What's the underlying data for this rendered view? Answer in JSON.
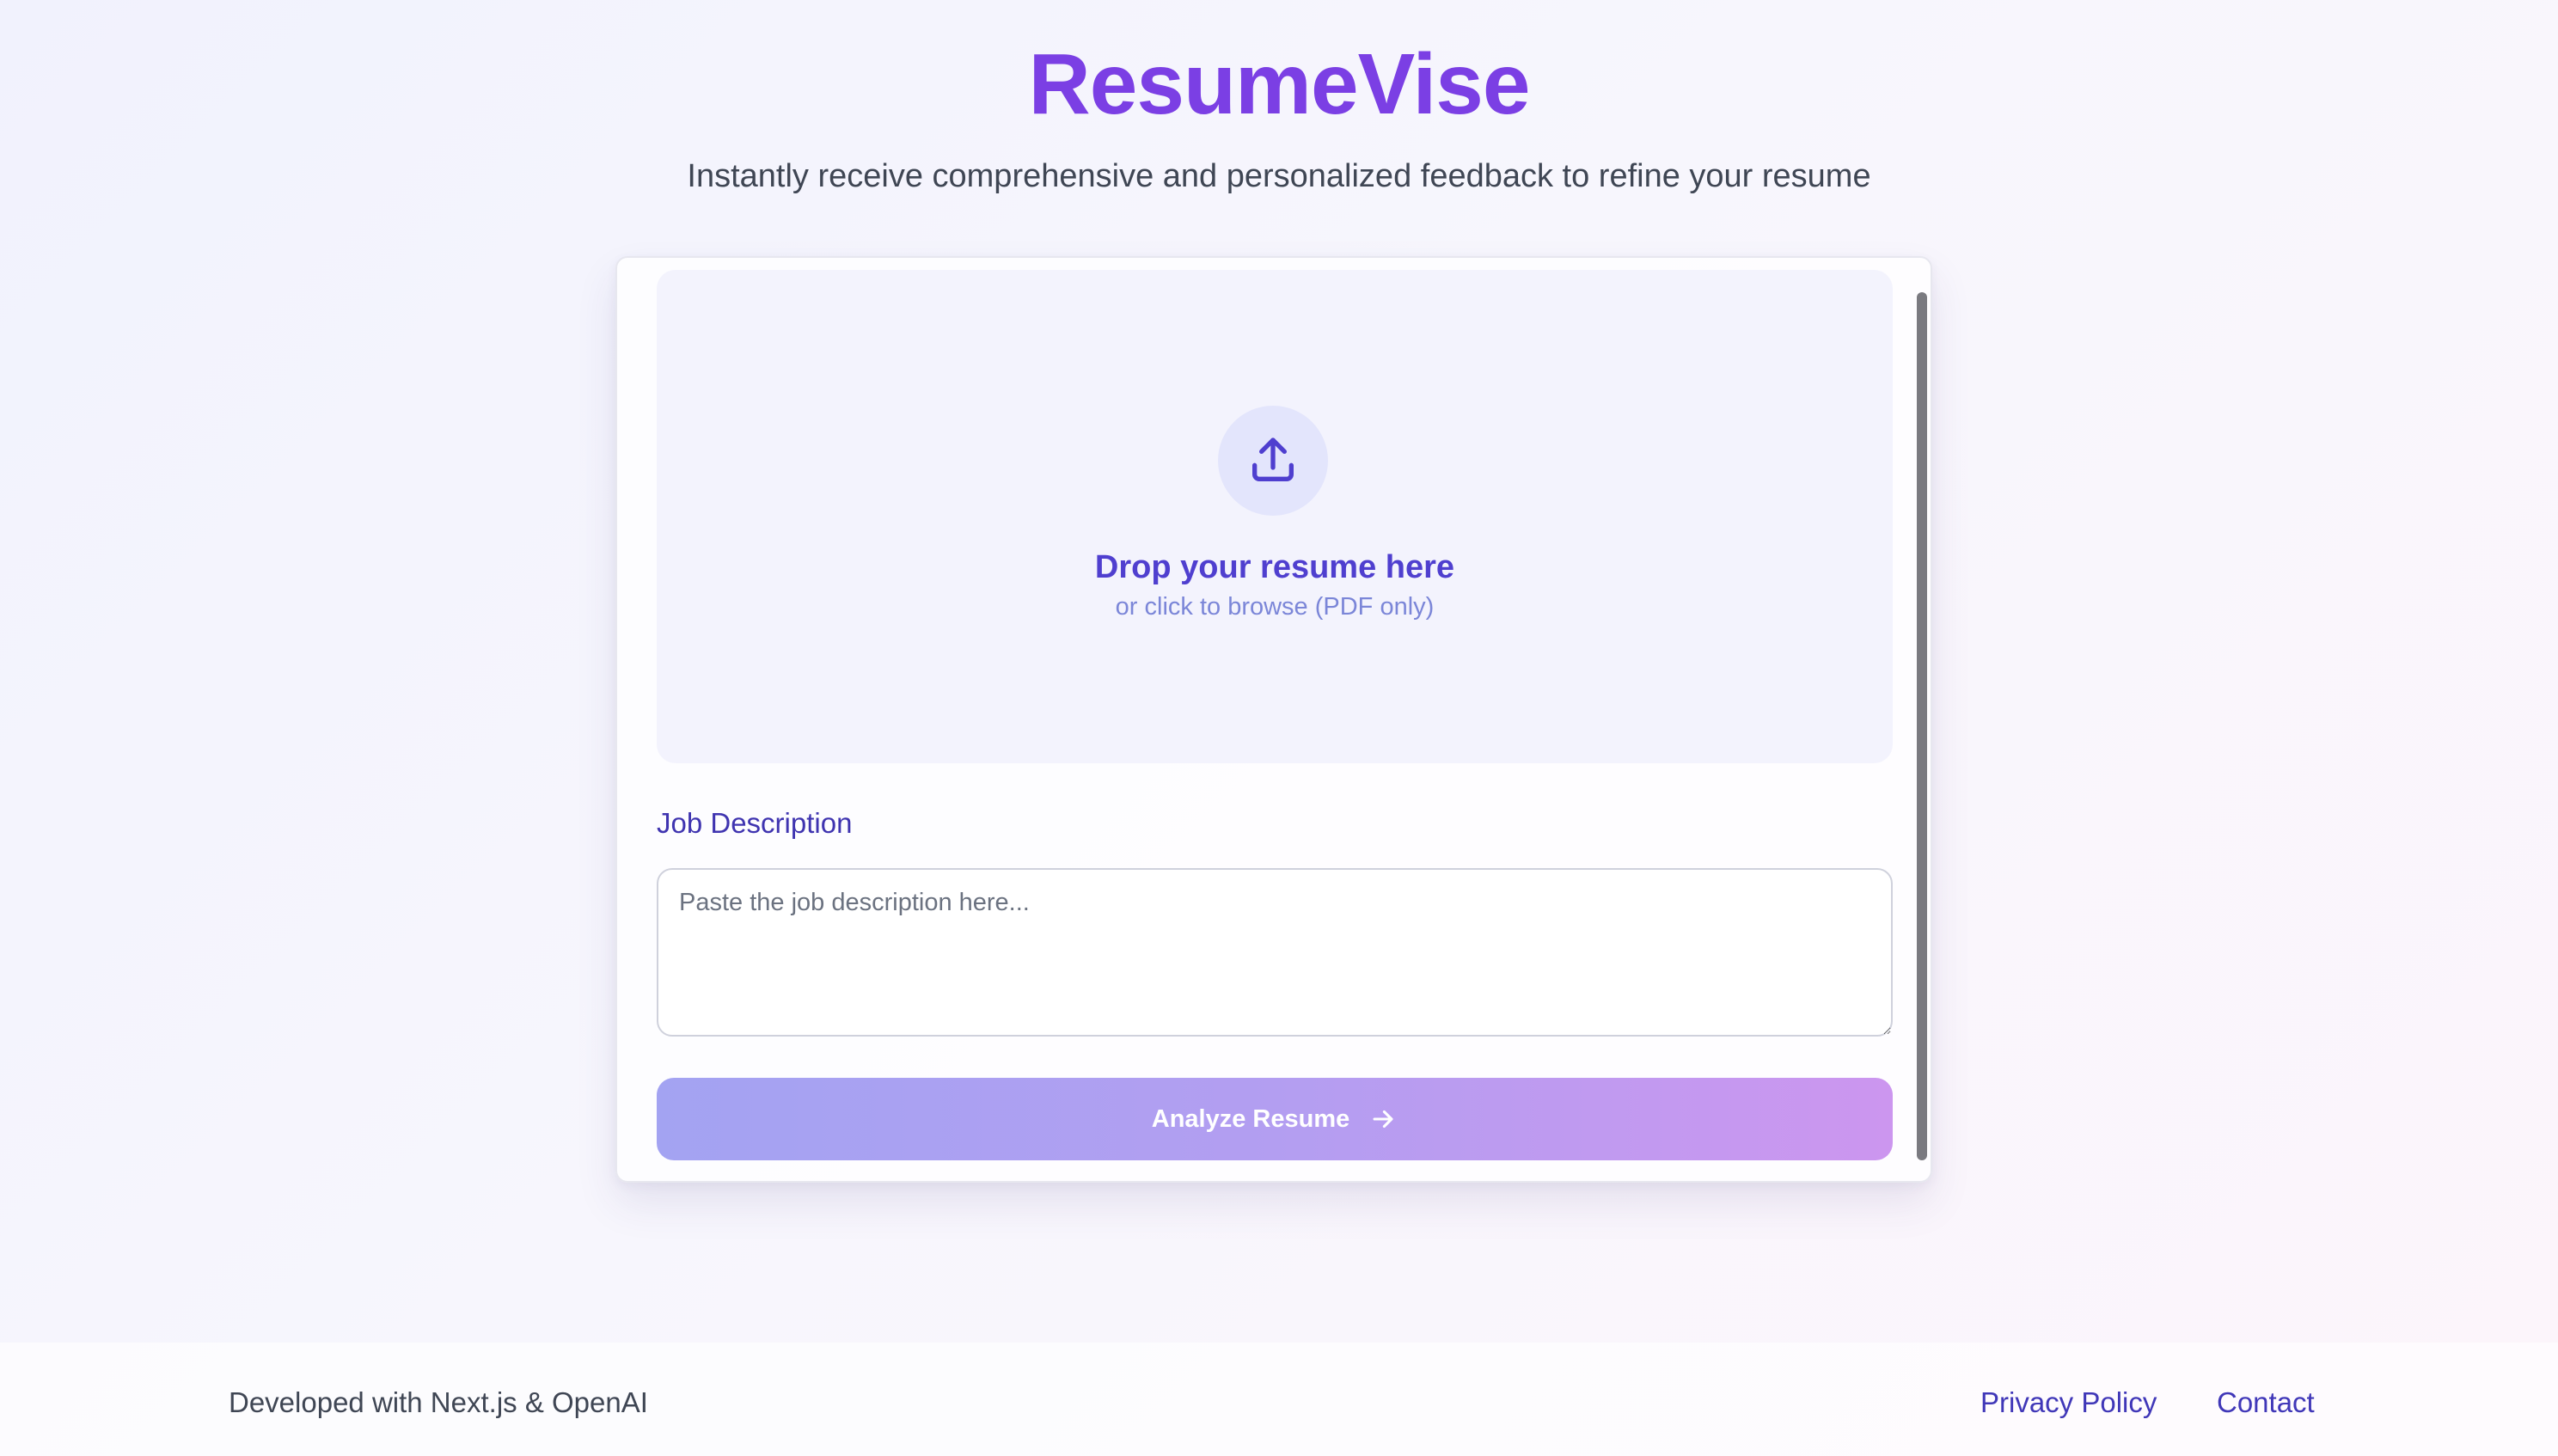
{
  "header": {
    "title": "ResumeVise",
    "tagline": "Instantly receive comprehensive and personalized feedback to refine your resume"
  },
  "upload": {
    "icon": "upload-icon",
    "title": "Drop your resume here",
    "subtitle": "or click to browse (PDF only)"
  },
  "job_description": {
    "label": "Job Description",
    "placeholder": "Paste the job description here...",
    "value": ""
  },
  "analyze_button": {
    "label": "Analyze Resume",
    "icon": "arrow-right-icon"
  },
  "footer": {
    "credit": "Developed with Next.js & OpenAI",
    "links": [
      "Privacy Policy",
      "Contact"
    ]
  },
  "colors": {
    "brand": "#7b3fe4",
    "accent": "#4f3fcf",
    "button_gradient_start": "#a3a3f2",
    "button_gradient_end": "#cc96ef"
  }
}
